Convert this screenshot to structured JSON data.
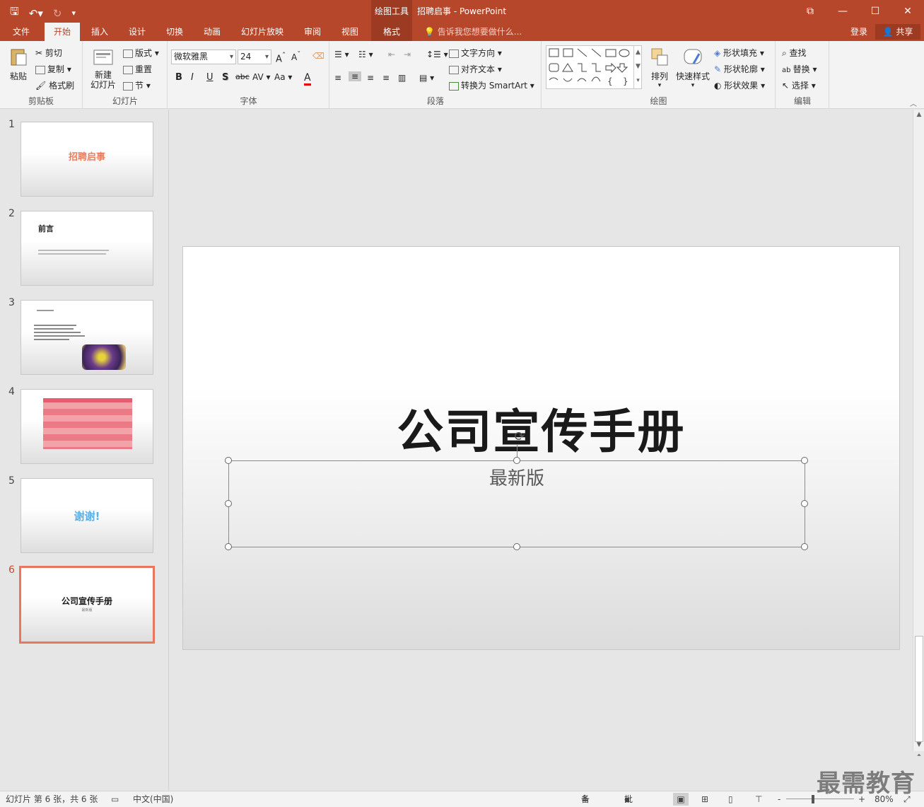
{
  "titlebar": {
    "context_tools": "绘图工具",
    "title": "招聘启事 - PowerPoint",
    "qat": {
      "save_icon": "save-icon",
      "undo_icon": "undo-icon",
      "redo_icon": "redo-icon",
      "customize_icon": "customize-icon"
    }
  },
  "tabs": {
    "file": "文件",
    "home": "开始",
    "insert": "插入",
    "design": "设计",
    "transitions": "切换",
    "animations": "动画",
    "slideshow": "幻灯片放映",
    "review": "审阅",
    "view": "视图",
    "format": "格式",
    "tell_me": "告诉我您想要做什么...",
    "login": "登录",
    "share": "共享"
  },
  "ribbon": {
    "clipboard": {
      "label": "剪贴板",
      "paste": "粘贴",
      "cut": "剪切",
      "copy": "复制",
      "format_painter": "格式刷"
    },
    "slides": {
      "label": "幻灯片",
      "new_slide_line1": "新建",
      "new_slide_line2": "幻灯片",
      "layout": "版式",
      "reset": "重置",
      "section": "节"
    },
    "font": {
      "label": "字体",
      "font_name": "微软雅黑",
      "font_size": "24",
      "bold": "B",
      "italic": "I",
      "underline": "U",
      "shadow": "S",
      "strike": "abc",
      "spacing": "AV",
      "case": "Aa",
      "color": "A"
    },
    "paragraph": {
      "label": "段落",
      "text_direction": "文字方向",
      "align_text": "对齐文本",
      "smartart": "转换为 SmartArt"
    },
    "drawing": {
      "label": "绘图",
      "arrange": "排列",
      "quick_styles": "快速样式",
      "shape_fill": "形状填充",
      "shape_outline": "形状轮廓",
      "shape_effects": "形状效果"
    },
    "editing": {
      "label": "编辑",
      "find": "查找",
      "replace": "替换",
      "select": "选择"
    }
  },
  "thumbnails": [
    {
      "num": "1",
      "title": "招聘启事"
    },
    {
      "num": "2",
      "title": "前言"
    },
    {
      "num": "3",
      "title": ""
    },
    {
      "num": "4",
      "title": ""
    },
    {
      "num": "5",
      "title": "谢谢!"
    },
    {
      "num": "6",
      "title": "公司宣传手册",
      "subtitle": "最新版"
    }
  ],
  "slide": {
    "title": "公司宣传手册",
    "subtitle": "最新版"
  },
  "status": {
    "slide_info": "幻灯片 第 6 张，共 6 张",
    "language": "中文(中国)",
    "notes": "备注",
    "comments": "批注",
    "zoom_minus": "-",
    "zoom_plus": "+",
    "zoom": "80%"
  },
  "watermark": "最需教育",
  "colors": {
    "accent": "#b7472a",
    "selected_thumb_border": "#e8775d"
  }
}
